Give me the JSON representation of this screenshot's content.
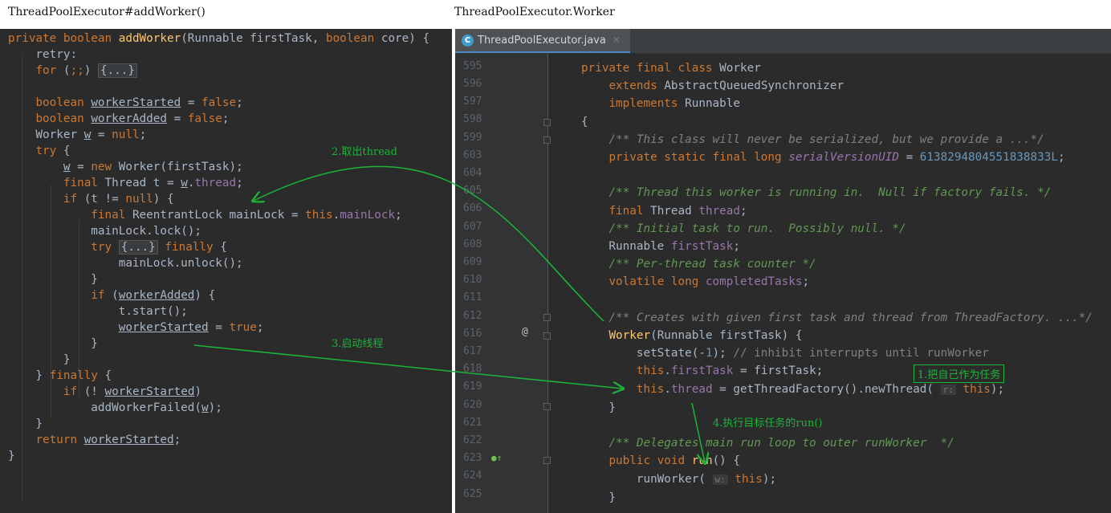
{
  "captions": {
    "left": "ThreadPoolExecutor#addWorker()",
    "right": "ThreadPoolExecutor.Worker"
  },
  "editor": {
    "tab_label": "ThreadPoolExecutor.java",
    "tab_icon": "java-class-icon",
    "close_icon": "close-icon"
  },
  "line_numbers": [
    "595",
    "596",
    "597",
    "598",
    "599",
    "603",
    "604",
    "605",
    "606",
    "607",
    "608",
    "609",
    "610",
    "611",
    "612",
    "616",
    "617",
    "618",
    "619",
    "620",
    "621",
    "622",
    "623",
    "624",
    "625"
  ],
  "inlay_hints": {
    "thread_factory": "r:",
    "run_worker": "w:"
  },
  "annotations": {
    "step1": "1.把自己作为任务",
    "step2": "2.取出thread",
    "step3": "3.启动线程",
    "step4": "4.执行目标任务的run()"
  },
  "colors": {
    "editor_bg": "#2b2b2b",
    "keyword": "#cc7832",
    "method": "#ffc66d",
    "field": "#9876aa",
    "number": "#6897bb",
    "doc_comment": "#629755",
    "annotation_green": "#1bb53a"
  }
}
